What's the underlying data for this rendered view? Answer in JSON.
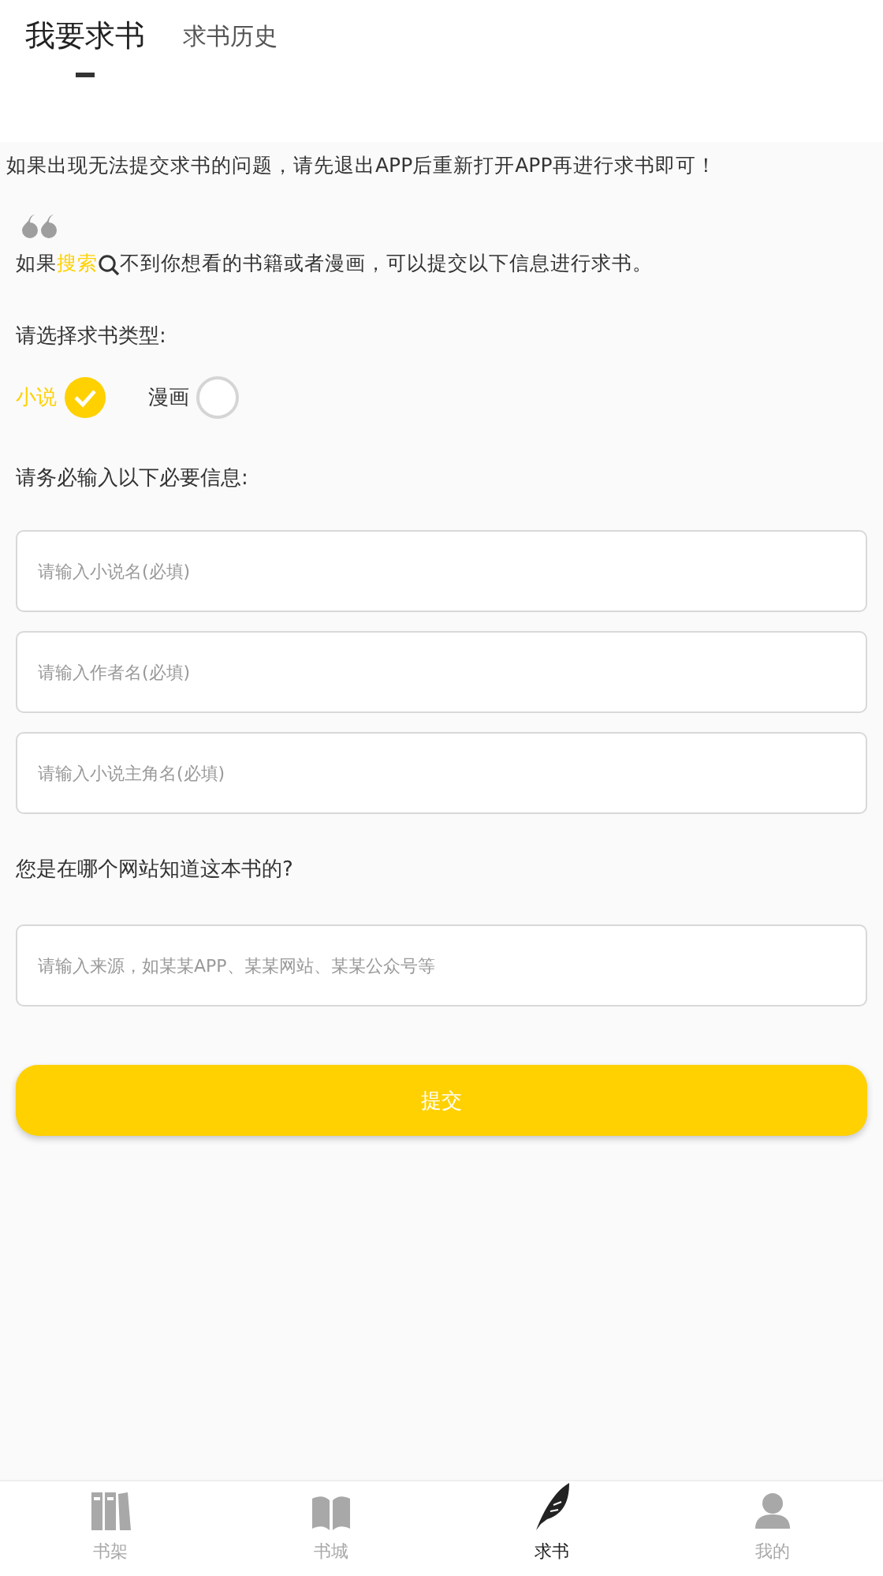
{
  "tabs": [
    {
      "label": "我要求书",
      "selected": true
    },
    {
      "label": "求书历史",
      "selected": false
    }
  ],
  "notice": "如果出现无法提交求书的问题，请先退出APP后重新打开APP再进行求书即可！",
  "intro": {
    "before": "如果",
    "link": "搜索",
    "after": "不到你想看的书籍或者漫画，可以提交以下信息进行求书。"
  },
  "type_label": "请选择求书类型:",
  "types": [
    {
      "label": "小说",
      "selected": true
    },
    {
      "label": "漫画",
      "selected": false
    }
  ],
  "required_label": "请务必输入以下必要信息:",
  "required_fields": [
    {
      "placeholder": "请输入小说名(必填)"
    },
    {
      "placeholder": "请输入作者名(必填)"
    },
    {
      "placeholder": "请输入小说主角名(必填)"
    }
  ],
  "source_label": "您是在哪个网站知道这本书的?",
  "source_field": {
    "placeholder": "请输入来源，如某某APP、某某网站、某某公众号等"
  },
  "submit": "提交",
  "nav": [
    {
      "kind": "shelf",
      "label": "书架",
      "selected": false
    },
    {
      "kind": "store",
      "label": "书城",
      "selected": false
    },
    {
      "kind": "request",
      "label": "求书",
      "selected": true
    },
    {
      "kind": "profile",
      "label": "我的",
      "selected": false
    }
  ]
}
